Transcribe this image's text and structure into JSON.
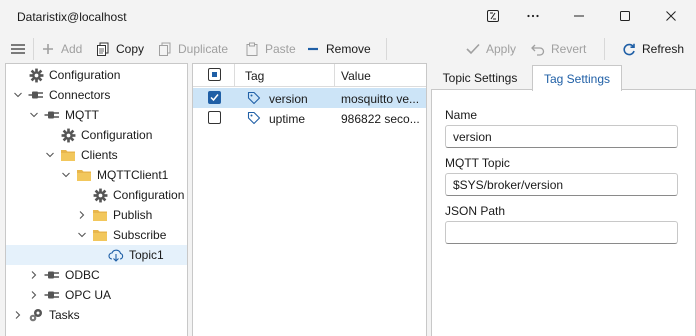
{
  "window": {
    "title": "Dataristix@localhost",
    "controls": [
      "snap-icon",
      "more-icon",
      "minimize-icon",
      "maximize-icon",
      "close-icon"
    ]
  },
  "toolbar": {
    "add": "Add",
    "copy": "Copy",
    "duplicate": "Duplicate",
    "paste": "Paste",
    "remove": "Remove",
    "apply": "Apply",
    "revert": "Revert",
    "refresh": "Refresh"
  },
  "tree": {
    "items": [
      {
        "label": "Configuration",
        "icon": "gear-icon",
        "expand": "none",
        "level": 0
      },
      {
        "label": "Connectors",
        "icon": "plug-icon",
        "expand": "expanded",
        "level": 0
      },
      {
        "label": "MQTT",
        "icon": "plug-icon",
        "expand": "expanded",
        "level": 1
      },
      {
        "label": "Configuration",
        "icon": "gear-icon",
        "expand": "none",
        "level": 2
      },
      {
        "label": "Clients",
        "icon": "folder-icon",
        "expand": "expanded",
        "level": 2
      },
      {
        "label": "MQTTClient1",
        "icon": "folder-icon",
        "expand": "expanded",
        "level": 3
      },
      {
        "label": "Configuration",
        "icon": "gear-icon",
        "expand": "none",
        "level": 4
      },
      {
        "label": "Publish",
        "icon": "folder-icon",
        "expand": "collapsed",
        "level": 4
      },
      {
        "label": "Subscribe",
        "icon": "folder-icon",
        "expand": "expanded",
        "level": 4
      },
      {
        "label": "Topic1",
        "icon": "download-icon",
        "expand": "none",
        "level": 5,
        "selected": true
      },
      {
        "label": "ODBC",
        "icon": "plug-icon",
        "expand": "collapsed",
        "level": 1
      },
      {
        "label": "OPC UA",
        "icon": "plug-icon",
        "expand": "collapsed",
        "level": 1
      },
      {
        "label": "Tasks",
        "icon": "gears-icon",
        "expand": "collapsed",
        "level": 0
      }
    ]
  },
  "grid": {
    "headers": {
      "tag": "Tag",
      "value": "Value"
    },
    "rows": [
      {
        "tag": "version",
        "value": "mosquitto ve...",
        "checked": true,
        "selected": true
      },
      {
        "tag": "uptime",
        "value": "986822 seco...",
        "checked": false,
        "selected": false
      }
    ]
  },
  "panel": {
    "tabs": [
      "Topic Settings",
      "Tag Settings"
    ],
    "active_tab": "Tag Settings",
    "fields": {
      "name_label": "Name",
      "name_value": "version",
      "topic_label": "MQTT Topic",
      "topic_value": "$SYS/broker/version",
      "json_label": "JSON Path",
      "json_value": ""
    }
  },
  "colors": {
    "accent": "#1f5fa6",
    "selection": "#cce4f7",
    "tree_selection": "#e5f1fb",
    "folder": "#e8b64c"
  }
}
